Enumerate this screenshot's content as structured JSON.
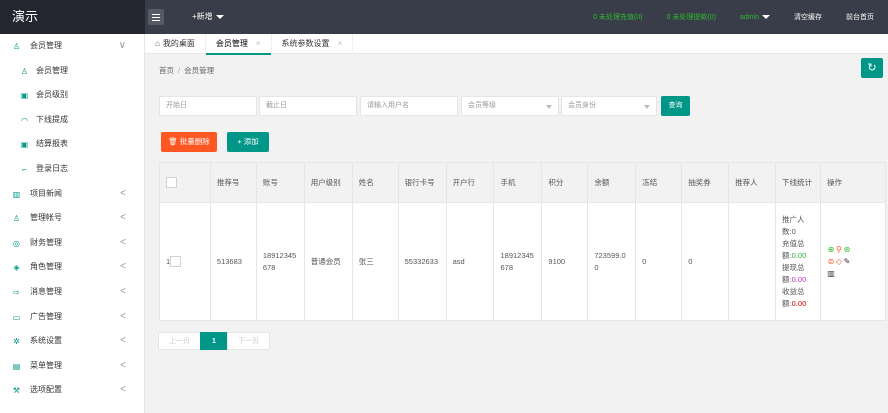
{
  "header": {
    "logo": "演示",
    "add_new": "+新增",
    "links": [
      "0 未处理充值(0)",
      "0 未处理提款(0)"
    ],
    "admin": "admin",
    "clear_cache": "清空缓存",
    "front_home": "前台首页"
  },
  "sidebar": {
    "items": [
      {
        "label": "会员管理",
        "icon": "user-icon",
        "arrow": "∨",
        "sub": false
      },
      {
        "label": "会员管理",
        "icon": "user-icon",
        "arrow": "",
        "sub": true
      },
      {
        "label": "会员级别",
        "icon": "edit-icon",
        "arrow": "",
        "sub": true
      },
      {
        "label": "下线提成",
        "icon": "chart-icon",
        "arrow": "",
        "sub": true
      },
      {
        "label": "结算报表",
        "icon": "edit-icon",
        "arrow": "",
        "sub": true
      },
      {
        "label": "登录日志",
        "icon": "log-icon",
        "arrow": "",
        "sub": true
      },
      {
        "label": "项目新闻",
        "icon": "news-icon",
        "arrow": "<",
        "sub": false
      },
      {
        "label": "管理帐号",
        "icon": "user-icon",
        "arrow": "<",
        "sub": false
      },
      {
        "label": "财务管理",
        "icon": "money-icon",
        "arrow": "<",
        "sub": false
      },
      {
        "label": "角色管理",
        "icon": "shield-icon",
        "arrow": "<",
        "sub": false
      },
      {
        "label": "消息管理",
        "icon": "message-icon",
        "arrow": "<",
        "sub": false
      },
      {
        "label": "广告管理",
        "icon": "ad-icon",
        "arrow": "<",
        "sub": false
      },
      {
        "label": "系统设置",
        "icon": "gear-icon",
        "arrow": "<",
        "sub": false
      },
      {
        "label": "菜单管理",
        "icon": "menu-icon",
        "arrow": "<",
        "sub": false
      },
      {
        "label": "选项配置",
        "icon": "option-icon",
        "arrow": "<",
        "sub": false
      }
    ]
  },
  "tabs": {
    "home": "我的桌面",
    "member": "会员管理",
    "params": "系统参数设置",
    "close": "×"
  },
  "breadcrumb": {
    "home": "首页",
    "sep": "/",
    "current": "会员管理"
  },
  "filters": {
    "start_date": "开始日",
    "end_date": "截止日",
    "username": "请输入用户名",
    "level": "会员等级",
    "identity": "会员身份",
    "search": "查询"
  },
  "actions": {
    "batch_delete": "批量删除",
    "add": "添加"
  },
  "table": {
    "headers": [
      "推荐号",
      "账号",
      "用户级别",
      "姓名",
      "银行卡号",
      "开户行",
      "手机",
      "积分",
      "余额",
      "冻结",
      "抽奖券",
      "推荐人",
      "下线统计",
      "操作"
    ],
    "row": {
      "index": "1",
      "referral_no": "513683",
      "account": "18912345678",
      "level": "普通会员",
      "name": "张三",
      "bank_card": "55332633",
      "bank": "asd",
      "phone": "18912345678",
      "points": "9100",
      "balance": "723599.00",
      "frozen": "0",
      "lottery": "0",
      "referrer": "",
      "stats": {
        "promoters_label": "推广人数:",
        "promoters": "0",
        "recharge_label": "充值总额:",
        "recharge": "0.00",
        "withdraw_label": "提现总额:",
        "withdraw": "0.00",
        "income_label": "收益总额:",
        "income": "0.00"
      }
    }
  },
  "pager": {
    "prev": "上一页",
    "current": "1",
    "next": "下一页"
  },
  "colors": {
    "primary": "#009688",
    "danger": "#ff5722",
    "header": "#393d49"
  }
}
